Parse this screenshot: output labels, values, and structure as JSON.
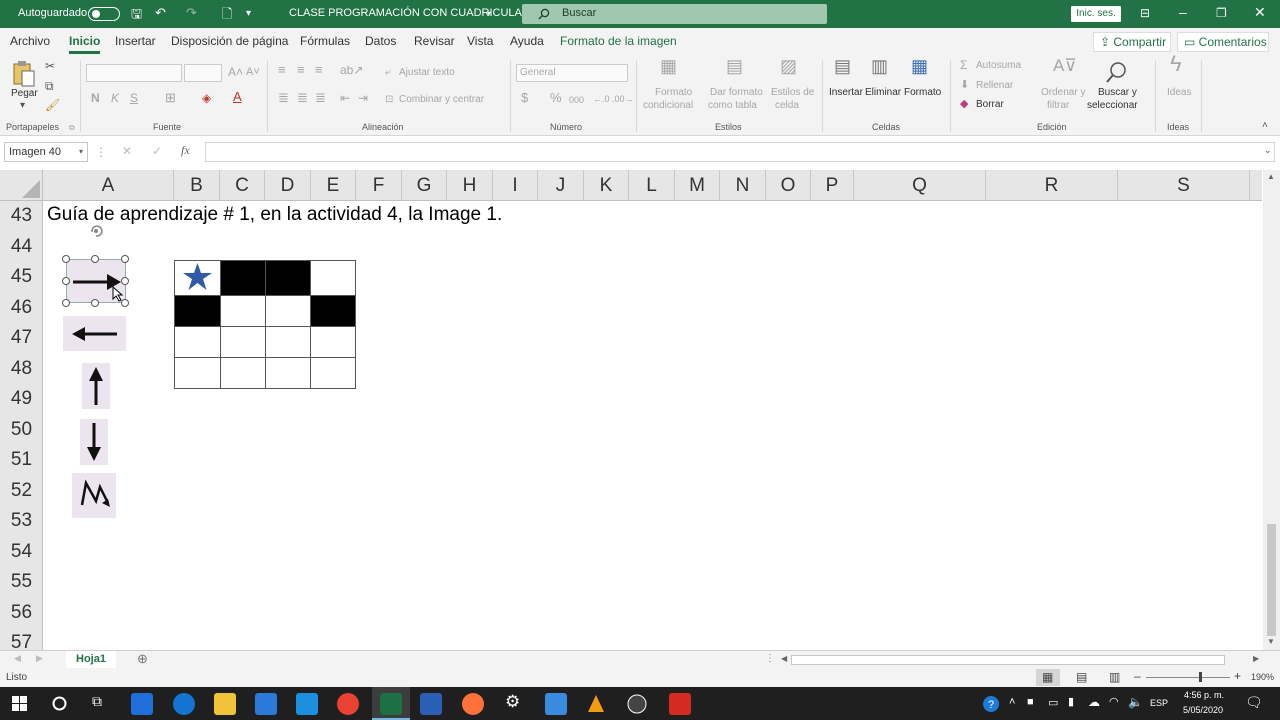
{
  "titlebar": {
    "autosave_label": "Autoguardado",
    "doc_title": "CLASE PROGRAMACIÓN CON CUADRICULA",
    "search_placeholder": "Buscar",
    "signin": "Inic. ses.",
    "accent": "#217346"
  },
  "menu": {
    "items": [
      "Archivo",
      "Inicio",
      "Insertar",
      "Disposición de página",
      "Fórmulas",
      "Datos",
      "Revisar",
      "Vista",
      "Ayuda",
      "Formato de la imagen"
    ],
    "share": "Compartir",
    "comments": "Comentarios"
  },
  "ribbon": {
    "clipboard": {
      "paste": "Pegar",
      "group": "Portapapeles"
    },
    "font": {
      "bold": "N",
      "italic": "K",
      "underline": "S",
      "group": "Fuente"
    },
    "alignment": {
      "wrap": "Ajustar texto",
      "merge": "Combinar y centrar",
      "group": "Alineación"
    },
    "number": {
      "format": "General",
      "group": "Número"
    },
    "styles": {
      "conditional_1": "Formato",
      "conditional_2": "condicional",
      "table_1": "Dar formato",
      "table_2": "como tabla",
      "cell_1": "Estilos de",
      "cell_2": "celda",
      "group": "Estilos"
    },
    "cells": {
      "insert": "Insertar",
      "delete": "Eliminar",
      "format": "Formato",
      "group": "Celdas"
    },
    "editing": {
      "autosum": "Autosuma",
      "fill": "Rellenar",
      "clear": "Borrar",
      "sort_1": "Ordenar y",
      "sort_2": "filtrar",
      "find_1": "Buscar y",
      "find_2": "seleccionar",
      "group": "Edición"
    },
    "ideas": {
      "label": "Ideas",
      "group": "Ideas"
    }
  },
  "formula_bar": {
    "name_box": "Imagen 40",
    "cancel": "✕",
    "enter": "✓",
    "fx": "fx",
    "value": ""
  },
  "sheet": {
    "columns": [
      "A",
      "B",
      "C",
      "D",
      "E",
      "F",
      "G",
      "H",
      "I",
      "J",
      "K",
      "L",
      "M",
      "N",
      "O",
      "P",
      "Q",
      "R",
      "S"
    ],
    "rows": [
      "43",
      "44",
      "45",
      "46",
      "47",
      "48",
      "49",
      "50",
      "51",
      "52",
      "53",
      "54",
      "55",
      "56",
      "57"
    ],
    "cell_a43": "Guía de aprendizaje # 1, en la actividad 4, la Image 1.",
    "arrow_images": [
      "arrow-right",
      "arrow-left",
      "arrow-up",
      "arrow-down",
      "zigzag-jump"
    ],
    "board": [
      [
        "star",
        "black",
        "black",
        "white"
      ],
      [
        "black",
        "white",
        "white",
        "black"
      ],
      [
        "white",
        "white",
        "white",
        "white"
      ],
      [
        "white",
        "white",
        "white",
        "white"
      ]
    ],
    "star_color": "#2e5aa8"
  },
  "sheetbar": {
    "tab": "Hoja1"
  },
  "status": {
    "ready": "Listo",
    "zoom": "190%"
  },
  "taskbar": {
    "lang": "ESP",
    "time": "4:56 p. m.",
    "date": "5/05/2020"
  }
}
